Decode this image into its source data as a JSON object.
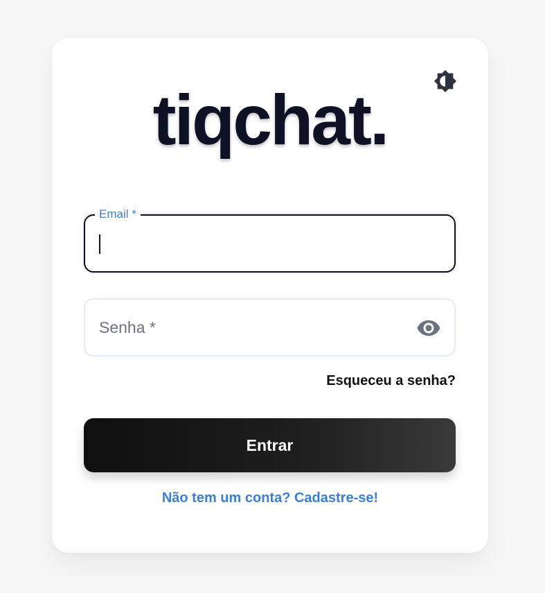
{
  "app": {
    "logo_text": "tiqchat."
  },
  "theme_toggle": {
    "icon": "brightness-icon"
  },
  "form": {
    "email": {
      "label": "Email *",
      "value": ""
    },
    "password": {
      "label": "Senha *",
      "icon": "eye-icon"
    },
    "forgot_password": "Esqueceu a senha?",
    "submit_label": "Entrar",
    "signup_link": "Não tem um conta? Cadastre-se!"
  },
  "colors": {
    "accent": "#3b7fd4",
    "logo": "#0f1224",
    "button": "#111111"
  }
}
